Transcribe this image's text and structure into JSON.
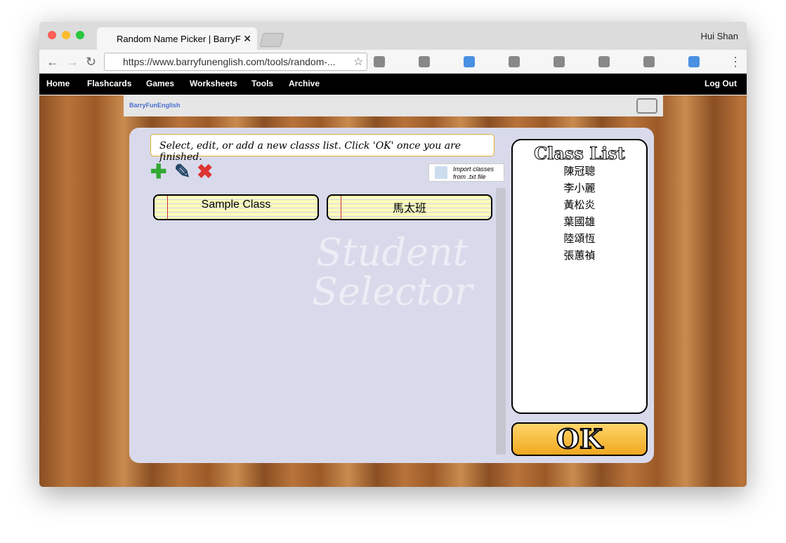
{
  "browser": {
    "tab_title": "Random Name Picker | BarryF",
    "user": "Hui Shan",
    "url": "https://www.barryfunenglish.com/tools/random-..."
  },
  "menu": [
    "Home",
    "Flashcards",
    "Games",
    "Worksheets",
    "Tools",
    "Archive"
  ],
  "logout": "Log Out",
  "logo": "BarryFunEnglish",
  "instruction": "Select, edit, or add a new classs list. Click 'OK' once you are finished.",
  "import_label": "Import classes from .txt file",
  "classes": [
    "Sample Class",
    "馬太班"
  ],
  "background_text": [
    "Student",
    "Selector"
  ],
  "class_list": {
    "title": "Class List",
    "names": [
      "陳冠聰",
      "李小麗",
      "黃松炎",
      "葉國雄",
      "陸頌恆",
      "張蕙禎"
    ]
  },
  "ok": "OK",
  "colors": {
    "menu_bg": "#000000",
    "ok_gold": "#f0a820"
  }
}
